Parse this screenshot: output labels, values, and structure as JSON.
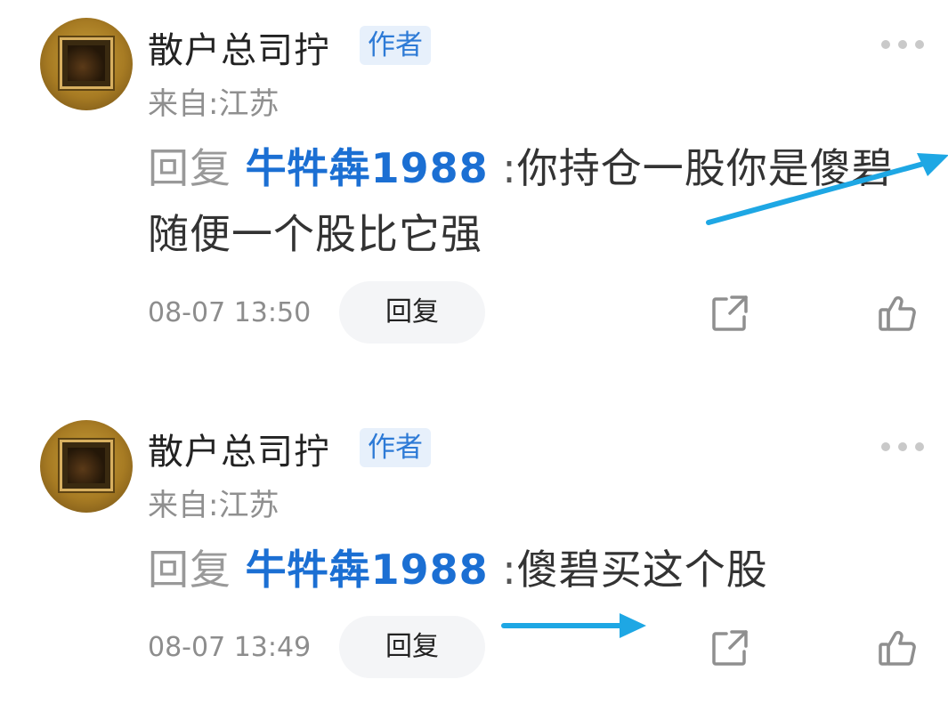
{
  "comments": [
    {
      "author": "散户总司拧",
      "badge": "作者",
      "location": "来自:江苏",
      "reply_prefix": "回复",
      "mention": "牛牪犇1988",
      "colon": ":",
      "text": "你持仓一股你是傻碧 随便一个股比它强",
      "time": "08-07 13:50",
      "reply_button": "回复"
    },
    {
      "author": "散户总司拧",
      "badge": "作者",
      "location": "来自:江苏",
      "reply_prefix": "回复",
      "mention": "牛牪犇1988",
      "colon": ":",
      "text": "傻碧买这个股",
      "time": "08-07 13:49",
      "reply_button": "回复"
    }
  ],
  "icons": {
    "more": "more-dots-icon",
    "share": "share-icon",
    "like": "thumbs-up-icon",
    "annotation": "arrow-annotation"
  },
  "colors": {
    "mention": "#1b6fd3",
    "badge_bg": "#e7f0fb",
    "badge_text": "#2d7ad6",
    "arrow": "#1ea7e4"
  }
}
